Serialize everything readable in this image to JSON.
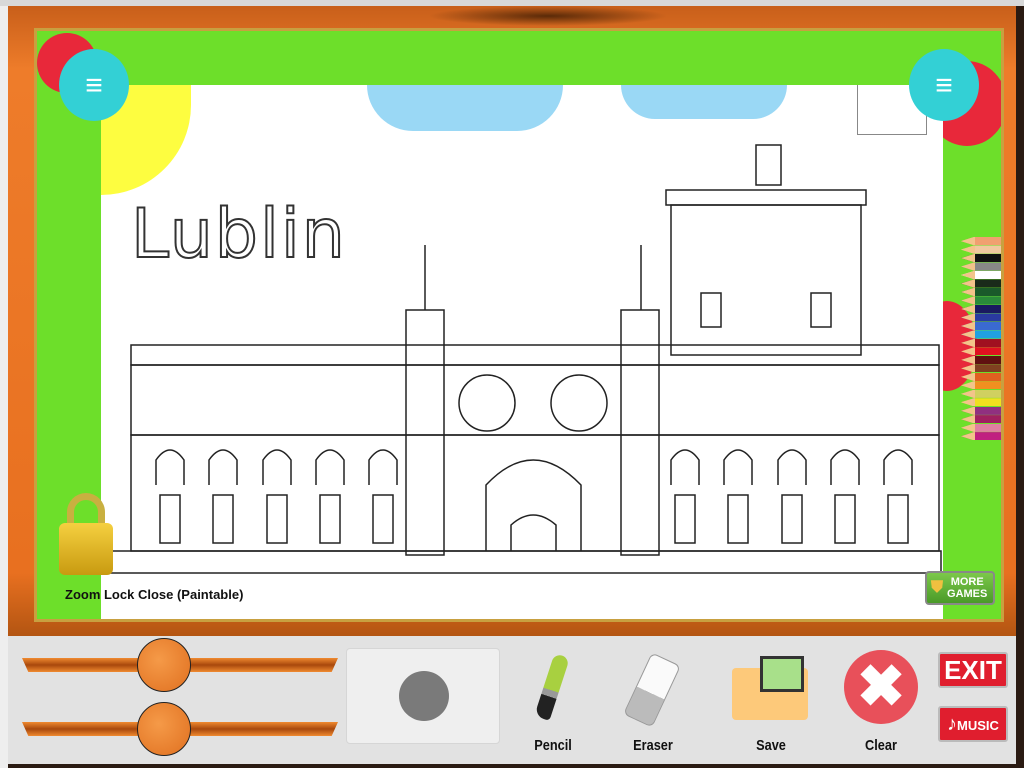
{
  "canvas": {
    "title": "Lublin"
  },
  "lock": {
    "label": "Zoom Lock Close (Paintable)",
    "state": "closed"
  },
  "more_games": {
    "label_line1": "MORE",
    "label_line2": "GAMES"
  },
  "toolbar": {
    "size_slider_value": 0.45,
    "opacity_slider_value": 0.45,
    "brush_preview_color": "#7a7a7a",
    "tools": [
      {
        "id": "pencil",
        "label": "Pencil"
      },
      {
        "id": "eraser",
        "label": "Eraser"
      },
      {
        "id": "save",
        "label": "Save"
      },
      {
        "id": "clear",
        "label": "Clear"
      }
    ],
    "exit_label": "EXIT",
    "music_label": "MUSIC"
  },
  "palette": [
    "#f0a070",
    "#f0c8a0",
    "#111111",
    "#888888",
    "#ffffff",
    "#1a2a1a",
    "#1a5a2a",
    "#2a8a3a",
    "#1a1a60",
    "#2a3aa0",
    "#3a6ad0",
    "#20a0e0",
    "#a01020",
    "#e01020",
    "#601010",
    "#804020",
    "#e06020",
    "#f09020",
    "#d0d060",
    "#f0e020",
    "#903080",
    "#a02060",
    "#e080a0",
    "#c02080"
  ],
  "colors": {
    "frame": "#e87020",
    "green": "#6ddf2a",
    "cyan": "#33d0d5",
    "red": "#e01e2e"
  }
}
